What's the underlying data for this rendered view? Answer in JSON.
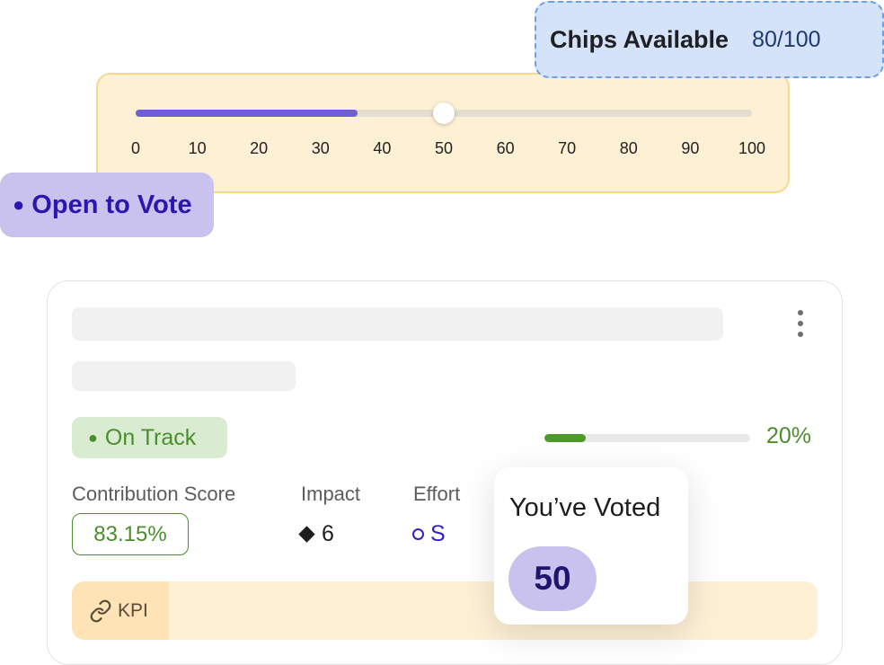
{
  "chips": {
    "label": "Chips Available",
    "value": "80/100"
  },
  "slider": {
    "value": 50,
    "fill_value": 36,
    "min": 0,
    "max": 100,
    "ticks": [
      "0",
      "10",
      "20",
      "30",
      "40",
      "50",
      "60",
      "70",
      "80",
      "90",
      "100"
    ]
  },
  "vote_status": {
    "label": "Open to Vote"
  },
  "card": {
    "status_badge": "On Track",
    "progress": {
      "value": 0.2,
      "label": "20%"
    },
    "metrics": {
      "contribution": {
        "label": "Contribution Score",
        "value": "83.15%"
      },
      "impact": {
        "label": "Impact",
        "value": "6",
        "icon": "diamond-icon"
      },
      "effort": {
        "label": "Effort",
        "value": "S",
        "icon": "ring-icon"
      }
    },
    "kpi": {
      "label": "KPI",
      "icon": "link-icon"
    }
  },
  "voted": {
    "title": "You’ve Voted",
    "value": "50"
  },
  "colors": {
    "accent_purple": "#6f5fd6",
    "success_green": "#4a8e2c",
    "chips_bg": "#d4e3f9",
    "panel_bg": "#fdf0d5"
  }
}
